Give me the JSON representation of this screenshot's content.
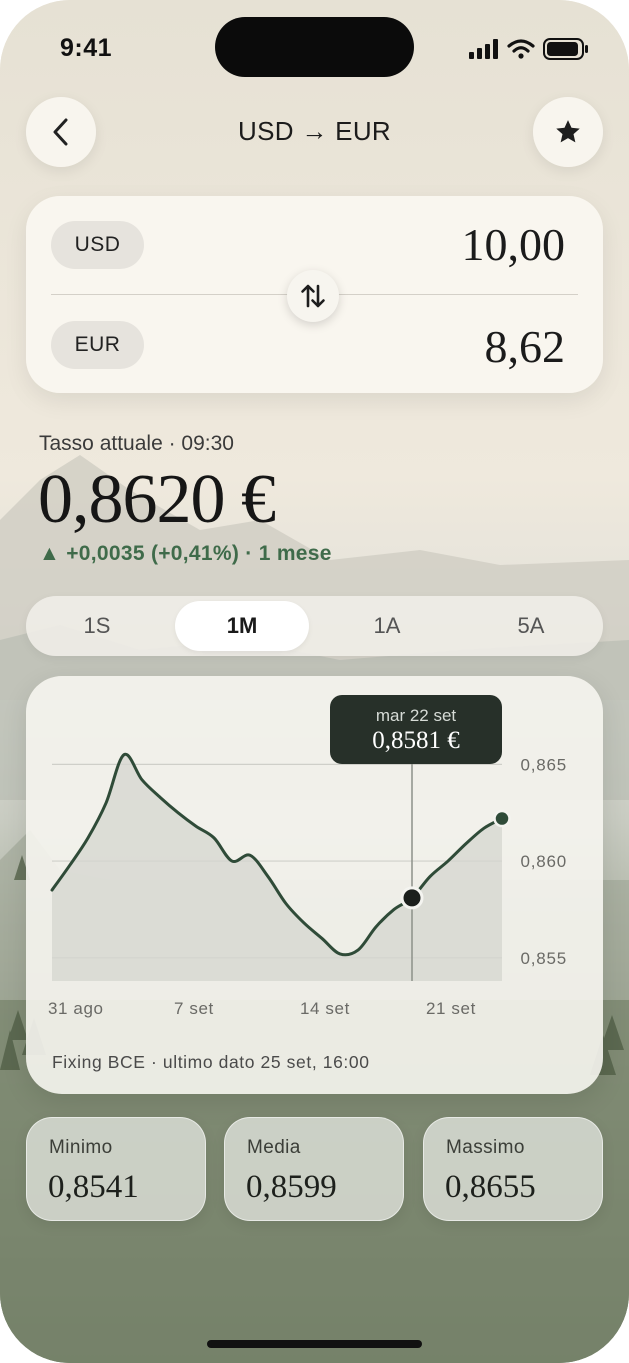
{
  "status_bar": {
    "time": "9:41"
  },
  "nav": {
    "title": "USD → EUR",
    "back_icon": "chevron-left-icon",
    "favorite_icon": "star-icon"
  },
  "converter": {
    "from": {
      "currency": "USD",
      "amount": "10,00"
    },
    "to": {
      "currency": "EUR",
      "amount": "8,62"
    },
    "swap_icon": "swap-vertical-icon"
  },
  "rate": {
    "label": "Tasso attuale · 09:30",
    "value": "0,8620 €",
    "change": "▲ +0,0035 (+0,41%) · 1 mese",
    "change_color": "#3f6b4a"
  },
  "periods": [
    {
      "label": "1S",
      "active": false
    },
    {
      "label": "1M",
      "active": true
    },
    {
      "label": "1A",
      "active": false
    },
    {
      "label": "5A",
      "active": false
    }
  ],
  "chart": {
    "tooltip": {
      "date": "mar 22 set",
      "value": "0,8581 €"
    },
    "footnote": "Fixing BCE · ultimo dato 25 set, 16:00"
  },
  "chart_data": {
    "type": "area",
    "x_tick_labels": [
      "31 ago",
      "7 set",
      "14 set",
      "21 set"
    ],
    "y_tick_labels": [
      "0,865",
      "0,860",
      "0,855"
    ],
    "y_ticks": [
      0.865,
      0.86,
      0.855
    ],
    "ylim": [
      0.8538,
      0.8675
    ],
    "x": [
      0,
      1,
      2,
      3,
      4,
      5,
      6,
      7,
      8,
      9,
      10,
      11,
      12,
      13,
      14,
      15,
      16,
      17,
      18,
      19,
      20,
      21,
      22,
      23,
      24,
      25
    ],
    "values": [
      0.8585,
      0.8598,
      0.8612,
      0.863,
      0.8655,
      0.8642,
      0.8633,
      0.8625,
      0.8618,
      0.8612,
      0.86,
      0.8603,
      0.8592,
      0.8578,
      0.8568,
      0.856,
      0.8552,
      0.8554,
      0.8566,
      0.8575,
      0.8581,
      0.8592,
      0.86,
      0.8609,
      0.8617,
      0.8622
    ],
    "x_tick_positions": [
      0,
      7,
      14,
      21
    ],
    "highlight_index": 20,
    "line_color": "#2f4b38",
    "grid": true
  },
  "stats": [
    {
      "label": "Minimo",
      "value": "0,8541"
    },
    {
      "label": "Media",
      "value": "0,8599"
    },
    {
      "label": "Massimo",
      "value": "0,8655"
    }
  ]
}
